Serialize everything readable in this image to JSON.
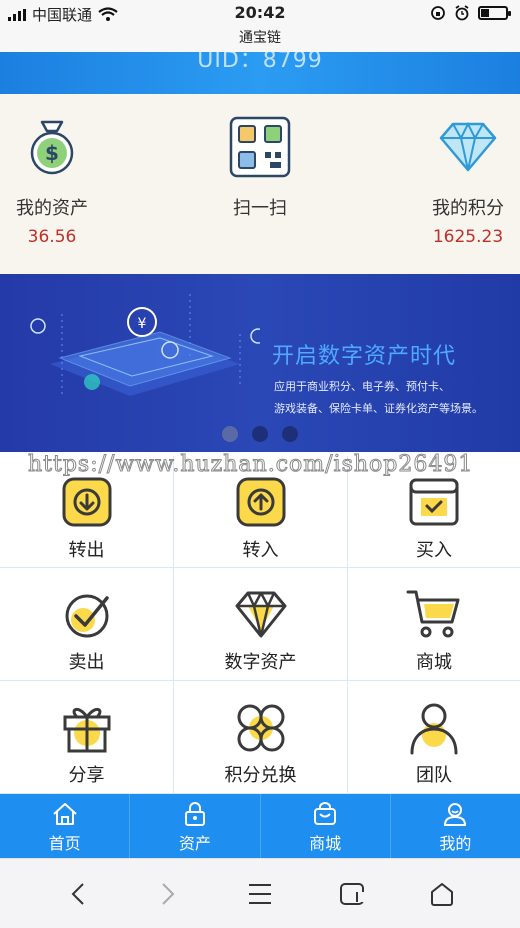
{
  "status_bar": {
    "carrier": "中国联通",
    "time": "20:42",
    "app_title": "通宝链",
    "battery_level": 0.35
  },
  "header": {
    "uid_text": "UID：8799"
  },
  "summary": {
    "items": [
      {
        "label": "我的资产",
        "value": "36.56",
        "icon": "money-bag-icon"
      },
      {
        "label": "扫一扫",
        "value": "",
        "icon": "qr-scan-icon"
      },
      {
        "label": "我的积分",
        "value": "1625.23",
        "icon": "diamond-icon"
      }
    ]
  },
  "banner": {
    "title": "开启数字资产时代",
    "desc_line1": "应用于商业积分、电子券、预付卡、",
    "desc_line2": "游戏装备、保险卡单、证券化资产等场景。",
    "active_dot": 0
  },
  "watermark": "https://www.huzhan.com/ishop26491",
  "grid": {
    "items": [
      {
        "label": "转出",
        "icon": "transfer-out-icon"
      },
      {
        "label": "转入",
        "icon": "transfer-in-icon"
      },
      {
        "label": "买入",
        "icon": "buy-icon"
      },
      {
        "label": "卖出",
        "icon": "sell-icon"
      },
      {
        "label": "数字资产",
        "icon": "digital-asset-icon"
      },
      {
        "label": "商城",
        "icon": "cart-icon"
      },
      {
        "label": "分享",
        "icon": "gift-icon"
      },
      {
        "label": "积分兑换",
        "icon": "exchange-icon"
      },
      {
        "label": "团队",
        "icon": "team-icon"
      }
    ]
  },
  "nav": {
    "tabs": [
      {
        "label": "首页",
        "icon": "home-icon"
      },
      {
        "label": "资产",
        "icon": "lock-icon"
      },
      {
        "label": "商城",
        "icon": "shop-bag-icon"
      },
      {
        "label": "我的",
        "icon": "user-icon"
      }
    ]
  },
  "colors": {
    "primary": "#1e8ef0",
    "value_red": "#c0302a",
    "icon_yellow": "#fbd94a",
    "banner_bg": "#2a48b6"
  }
}
